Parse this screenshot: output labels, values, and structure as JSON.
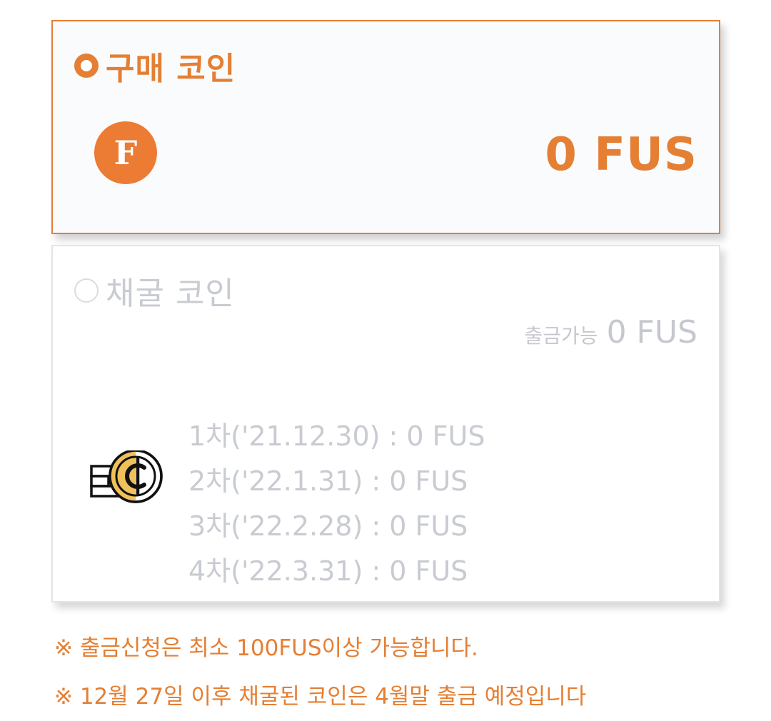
{
  "buy_card": {
    "title": "구매 코인",
    "coin_letter": "F",
    "amount": "0 FUS",
    "selected": true
  },
  "mining_card": {
    "title": "채굴 코인",
    "withdrawable_label": "출금가능",
    "withdrawable_amount": "0 FUS",
    "selected": false,
    "schedule": [
      "1차('21.12.30) : 0 FUS",
      "2차('22.1.31) : 0 FUS",
      "3차('22.2.28) : 0 FUS",
      "4차('22.3.31) : 0 FUS"
    ]
  },
  "notes": [
    "※ 출금신청은 최소 100FUS이상 가능합니다.",
    "※ 12월 27일 이후 채굴된 코인은 4월말 출금 예정입니다"
  ],
  "colors": {
    "accent": "#e47f34",
    "coin_orange": "#ec7b34",
    "muted_text": "#c8cbd1",
    "coin_gold": "#f0c05a"
  },
  "icons": {
    "buy_coin": "fus-coin-icon",
    "mining_coin": "coin-stack-icon"
  }
}
